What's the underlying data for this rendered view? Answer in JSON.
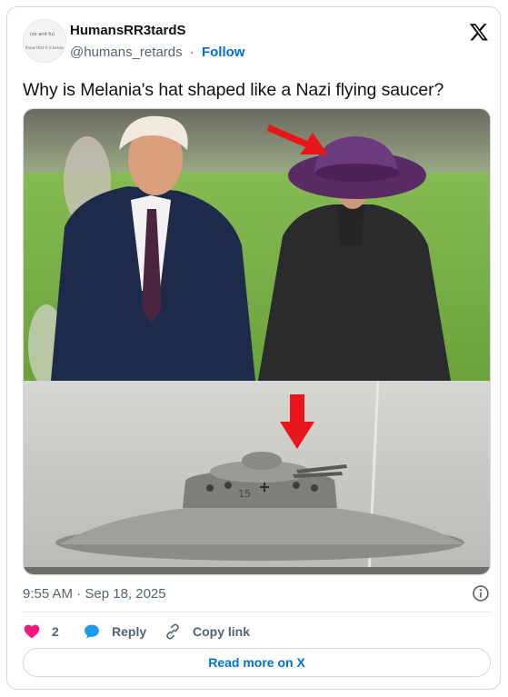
{
  "author": {
    "display_name": "HumansRR3tardS",
    "handle": "@humans_retards",
    "separator": "·",
    "follow_label": "Follow",
    "avatar_text_top": "(so and fu)",
    "avatar_text_bottom": "Know that it is below"
  },
  "tweet": {
    "text": "Why is Melania's hat shaped like a Nazi flying saucer?",
    "timestamp": "9:55 AM · Sep 18, 2025"
  },
  "media": {
    "top_image": "photo-couple-walking-purple-hat",
    "bottom_image": "photo-flying-saucer-vintage",
    "arrow_color": "#e8151b"
  },
  "actions": {
    "like_count": "2",
    "reply_label": "Reply",
    "copy_link_label": "Copy link"
  },
  "read_more_label": "Read more on X",
  "colors": {
    "like": "#f91880",
    "reply": "#1d9bf0",
    "link": "#006fd6",
    "secondary_text": "#536471"
  }
}
